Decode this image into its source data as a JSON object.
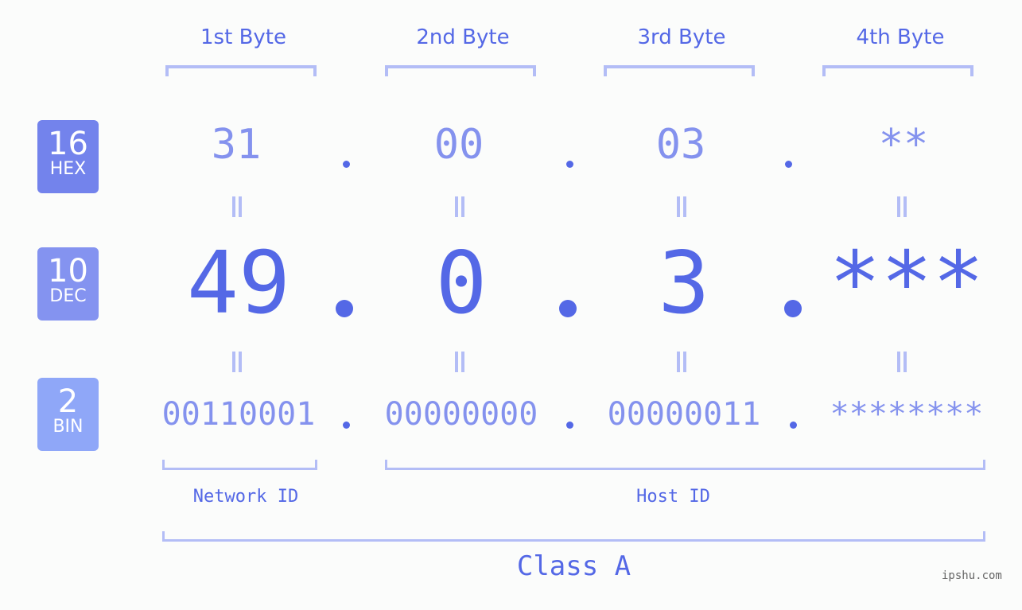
{
  "bytes": [
    {
      "label": "1st Byte",
      "hex": "31",
      "dec": "49",
      "bin": "00110001"
    },
    {
      "label": "2nd Byte",
      "hex": "00",
      "dec": "0",
      "bin": "00000000"
    },
    {
      "label": "3rd Byte",
      "hex": "03",
      "dec": "3",
      "bin": "00000011"
    },
    {
      "label": "4th Byte",
      "hex": "**",
      "dec": "***",
      "bin": "********"
    }
  ],
  "badges": {
    "hex": {
      "num": "16",
      "label": "HEX",
      "color": "#7383ec"
    },
    "dec": {
      "num": "10",
      "label": "DEC",
      "color": "#8493f0"
    },
    "bin": {
      "num": "2",
      "label": "BIN",
      "color": "#8fa7f8"
    }
  },
  "segments": {
    "network": "Network ID",
    "host": "Host ID"
  },
  "class_label": "Class A",
  "watermark": "ipshu.com",
  "colors": {
    "primary": "#5468e6",
    "secondary": "#8492ee",
    "bracket": "#b3bdf6",
    "background": "#fbfcfb"
  }
}
